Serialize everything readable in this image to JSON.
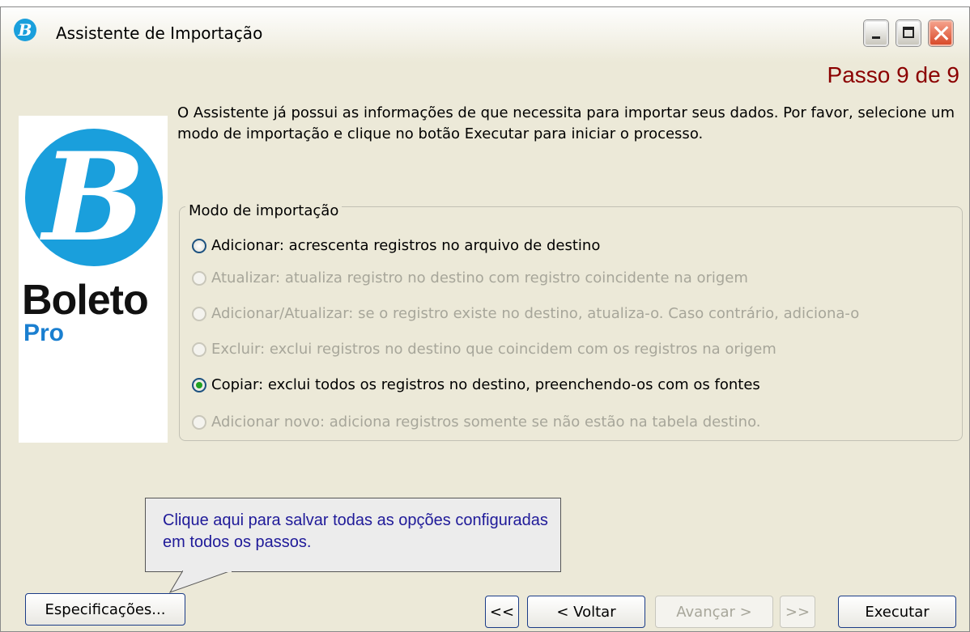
{
  "window": {
    "title": "Assistente de Importação",
    "step": "Passo 9 de 9"
  },
  "logo": {
    "mark": "B",
    "word": "Boleto",
    "sub": "Pro"
  },
  "intro": "O Assistente já possui as informações de que necessita para importar seus dados. Por favor, selecione um modo de importação e clique no botão Executar para iniciar o processo.",
  "mode_group": {
    "legend": "Modo de importação",
    "options": [
      {
        "label": "Adicionar: acrescenta registros no arquivo de destino",
        "checked": false,
        "enabled": true
      },
      {
        "label": "Atualizar: atualiza registro no destino com registro coincidente na origem",
        "checked": false,
        "enabled": false
      },
      {
        "label": "Adicionar/Atualizar: se o registro existe no destino, atualiza-o. Caso contrário, adiciona-o",
        "checked": false,
        "enabled": false
      },
      {
        "label": "Excluir: exclui registros no destino que coincidem com os registros na origem",
        "checked": false,
        "enabled": false
      },
      {
        "label": "Copiar: exclui todos os registros no destino, preenchendo-os com os fontes",
        "checked": true,
        "enabled": true
      },
      {
        "label": "Adicionar novo: adiciona registros somente se não estão na tabela destino.",
        "checked": false,
        "enabled": false
      }
    ]
  },
  "callout": {
    "text": "Clique aqui para salvar todas as opções configuradas em todos os passos."
  },
  "buttons": {
    "spec": "Especificações...",
    "first": "<<",
    "back": "< Voltar",
    "next": "Avançar >",
    "last": ">>",
    "run": "Executar"
  },
  "colors": {
    "accent": "#1a9fdc",
    "step_text": "#8b0000",
    "callout_text": "#1f1a99",
    "disabled_text": "#a7a69a"
  }
}
